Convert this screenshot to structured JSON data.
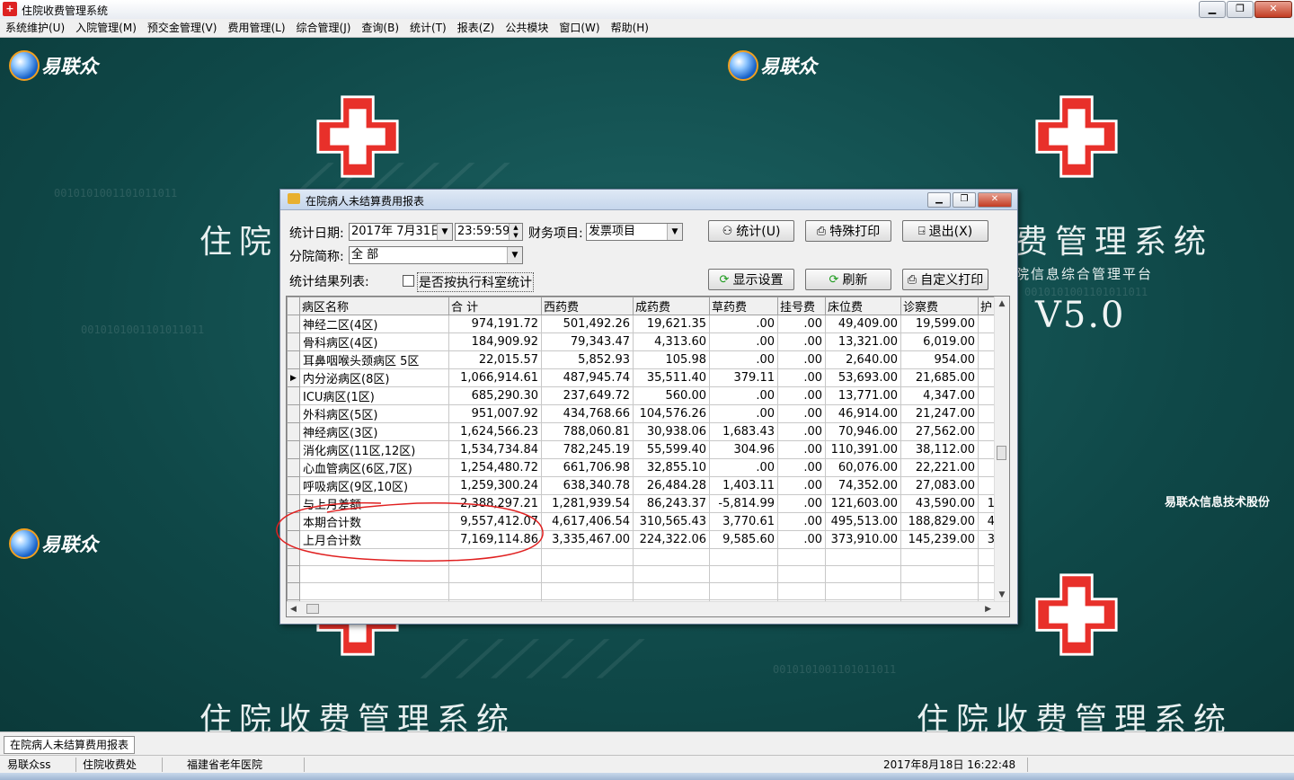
{
  "window": {
    "title": "住院收费管理系统",
    "min": "▁",
    "max": "❐",
    "close": "✕"
  },
  "menu": [
    "系统维护(U)",
    "入院管理(M)",
    "预交金管理(V)",
    "费用管理(L)",
    "综合管理(J)",
    "查询(B)",
    "统计(T)",
    "报表(Z)",
    "公共模块",
    "窗口(W)",
    "帮助(H)"
  ],
  "desktop": {
    "logo_text": "易联众",
    "big_title": "住院收费管理系统",
    "subtitle_fragment": "院信息综合管理平台",
    "version": "V5.0",
    "company_fragment": "易联众信息技术股份",
    "binary_text": "0010101001101011011",
    "cross_color": "#e8302a"
  },
  "dialog": {
    "title": "在院病人未结算费用报表",
    "stat_date_label": "统计日期:",
    "stat_date_value": "2017年 7月31日",
    "stat_time_value": "23:59:59",
    "finance_label": "财务项目:",
    "finance_value": "发票项目",
    "branch_label": "分院简称:",
    "branch_value": "全 部",
    "result_label": "统计结果列表:",
    "checkbox_label": "是否按执行科室统计",
    "buttons": {
      "stat": "统计(U)",
      "special_print": "特殊打印",
      "exit": "退出(X)",
      "display_settings": "显示设置",
      "refresh": "刷新",
      "custom_print": "自定义打印"
    },
    "icons": {
      "stat": "binoculars-icon",
      "print": "printer-icon",
      "exit": "door-exit-icon",
      "refresh": "refresh-icon"
    }
  },
  "grid": {
    "columns": [
      "病区名称",
      "合 计",
      "西药费",
      "成药费",
      "草药费",
      "挂号费",
      "床位费",
      "诊察费",
      "护"
    ],
    "rows": [
      [
        "神经二区(4区)",
        "974,191.72",
        "501,492.26",
        "19,621.35",
        ".00",
        ".00",
        "49,409.00",
        "19,599.00",
        ""
      ],
      [
        "骨科病区(4区)",
        "184,909.92",
        "79,343.47",
        "4,313.60",
        ".00",
        ".00",
        "13,321.00",
        "6,019.00",
        ""
      ],
      [
        "耳鼻咽喉头颈病区 5区",
        "22,015.57",
        "5,852.93",
        "105.98",
        ".00",
        ".00",
        "2,640.00",
        "954.00",
        ""
      ],
      [
        "内分泌病区(8区)",
        "1,066,914.61",
        "487,945.74",
        "35,511.40",
        "379.11",
        ".00",
        "53,693.00",
        "21,685.00",
        ""
      ],
      [
        "ICU病区(1区)",
        "685,290.30",
        "237,649.72",
        "560.00",
        ".00",
        ".00",
        "13,771.00",
        "4,347.00",
        ""
      ],
      [
        "外科病区(5区)",
        "951,007.92",
        "434,768.66",
        "104,576.26",
        ".00",
        ".00",
        "46,914.00",
        "21,247.00",
        ""
      ],
      [
        "神经病区(3区)",
        "1,624,566.23",
        "788,060.81",
        "30,938.06",
        "1,683.43",
        ".00",
        "70,946.00",
        "27,562.00",
        ""
      ],
      [
        "消化病区(11区,12区)",
        "1,534,734.84",
        "782,245.19",
        "55,599.40",
        "304.96",
        ".00",
        "110,391.00",
        "38,112.00",
        ""
      ],
      [
        "心血管病区(6区,7区)",
        "1,254,480.72",
        "661,706.98",
        "32,855.10",
        ".00",
        ".00",
        "60,076.00",
        "22,221.00",
        ""
      ],
      [
        "呼吸病区(9区,10区)",
        "1,259,300.24",
        "638,340.78",
        "26,484.28",
        "1,403.11",
        ".00",
        "74,352.00",
        "27,083.00",
        ""
      ],
      [
        "与上月差额",
        "2,388,297.21",
        "1,281,939.54",
        "86,243.37",
        "-5,814.99",
        ".00",
        "121,603.00",
        "43,590.00",
        "1"
      ],
      [
        "本期合计数",
        "9,557,412.07",
        "4,617,406.54",
        "310,565.43",
        "3,770.61",
        ".00",
        "495,513.00",
        "188,829.00",
        "4"
      ],
      [
        "上月合计数",
        "7,169,114.86",
        "3,335,467.00",
        "224,322.06",
        "9,585.60",
        ".00",
        "373,910.00",
        "145,239.00",
        "3"
      ]
    ],
    "current_row_marker": "▶"
  },
  "tabs": [
    "在院病人未结算费用报表"
  ],
  "status": {
    "user": "易联众ss",
    "dept": "住院收费处",
    "hospital": "福建省老年医院",
    "datetime": "2017年8月18日 16:22:48"
  }
}
